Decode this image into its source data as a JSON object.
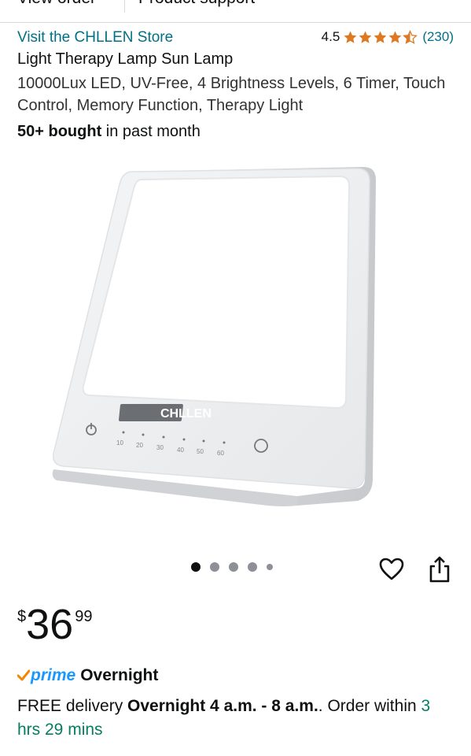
{
  "topbar": {
    "view_order": "View order",
    "product_support": "Product support"
  },
  "store": {
    "link_text": "Visit the CHLLEN Store"
  },
  "rating": {
    "value": "4.5",
    "stars": 4.5,
    "count": "(230)"
  },
  "product": {
    "title": "Light Therapy Lamp Sun Lamp",
    "subtitle": "10000Lux LED, UV-Free, 4 Brightness Levels, 6 Timer, Touch Control, Memory Function, Therapy Light",
    "bought_bold": "50+ bought",
    "bought_rest": " in past month",
    "image": {
      "brand": "CHLLEN",
      "timer_labels": [
        "10",
        "20",
        "30",
        "40",
        "50",
        "60"
      ]
    }
  },
  "carousel": {
    "total_images": 5,
    "active_index": 1
  },
  "price": {
    "symbol": "$",
    "whole": "36",
    "fraction": "99"
  },
  "prime": {
    "check": "✓",
    "label": "prime",
    "speed": "Overnight"
  },
  "delivery": {
    "prefix": "FREE delivery ",
    "window": "Overnight 4 a.m. - 8 a.m.",
    "mid": ". Order within ",
    "countdown": "3 hrs 29 mins"
  },
  "colors": {
    "link": "#007185",
    "star": "#de7921",
    "prime": "#1a98ff",
    "countdown": "#067d62",
    "text": "#0f1111"
  },
  "icons": {
    "heart": "heart-icon",
    "share": "share-icon",
    "star": "star-icon",
    "power": "power-icon",
    "prime_check": "check-icon"
  }
}
